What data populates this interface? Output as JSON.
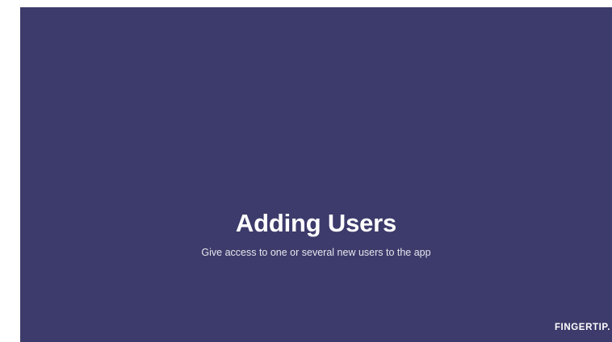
{
  "slide": {
    "title": "Adding Users",
    "subtitle": "Give access to one or several new users to the app",
    "logo_text": "FINGERTIP.",
    "background_color": "#3d3b6b",
    "text_color": "#ffffff"
  }
}
